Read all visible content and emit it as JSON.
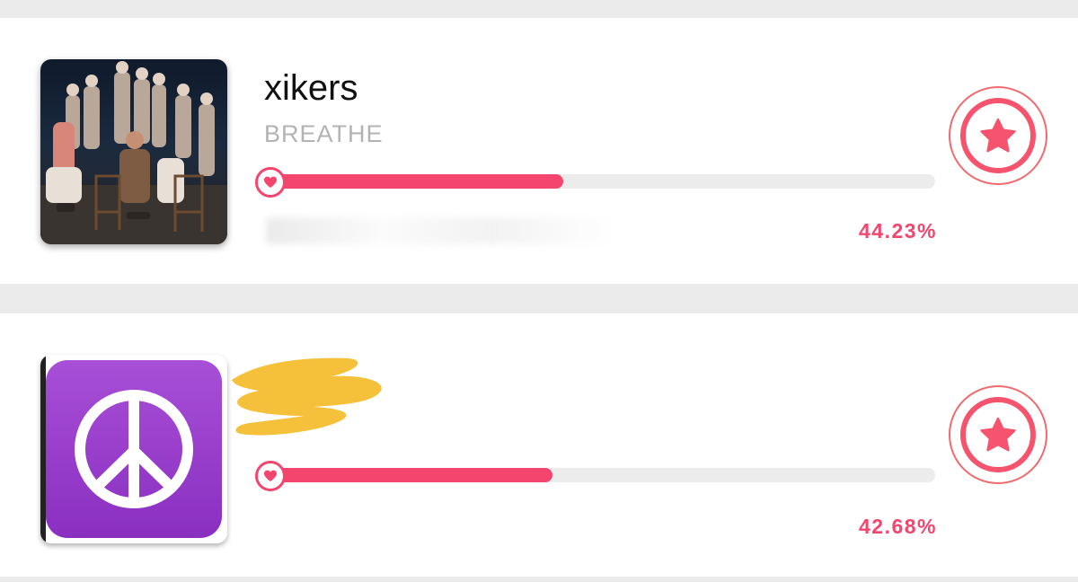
{
  "colors": {
    "accent": "#f4456e",
    "track": "#ececec",
    "background": "#ebebeb",
    "card": "#ffffff",
    "artist_text": "#111111",
    "song_text": "#b3b3b3",
    "star": "#f6546e",
    "peace_purple": "#9a3cc8",
    "highlighter": "#f5c03a"
  },
  "entries": [
    {
      "artist": "xikers",
      "song": "BREATHE",
      "percent_label": "44.23%",
      "progress_fraction": 0.4423,
      "thumbnail_icon": "group-photo",
      "vote_icon": "star-icon",
      "knob_icon": "heart-icon"
    },
    {
      "artist": "",
      "song": "",
      "percent_label": "42.68%",
      "progress_fraction": 0.4268,
      "thumbnail_icon": "peace-sign-icon",
      "vote_icon": "star-icon",
      "knob_icon": "heart-icon"
    }
  ]
}
